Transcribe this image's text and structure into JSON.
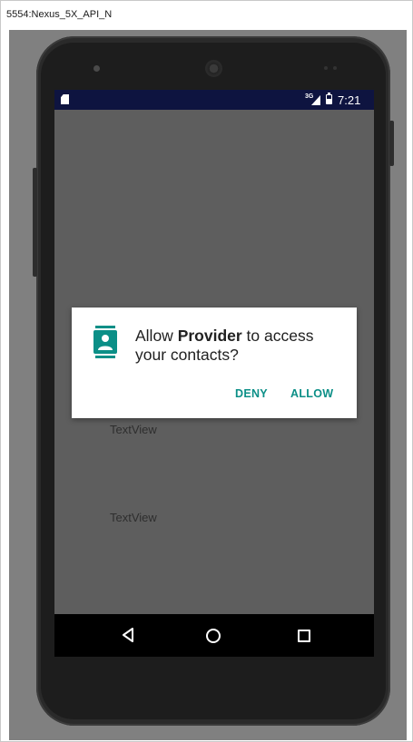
{
  "window": {
    "title": "5554:Nexus_5X_API_N"
  },
  "status_bar": {
    "network": "3G",
    "time": "7:21",
    "icons": [
      "sd-card-icon",
      "signal-icon",
      "battery-icon"
    ]
  },
  "app": {
    "textview_1": "TextView",
    "textview_2": "TextView"
  },
  "dialog": {
    "icon": "contacts-icon",
    "message_prefix": "Allow ",
    "app_name": "Provider",
    "message_suffix": " to access your contacts?",
    "deny_label": "DENY",
    "allow_label": "ALLOW",
    "accent_color": "#0b8f87"
  },
  "nav_bar": {
    "buttons": [
      "back-icon",
      "home-icon",
      "recents-icon"
    ]
  },
  "colors": {
    "status_bar": "#0e1440",
    "scrim_background": "#5e5e5e",
    "dialog_background": "#ffffff",
    "emulator_background": "#808080"
  }
}
